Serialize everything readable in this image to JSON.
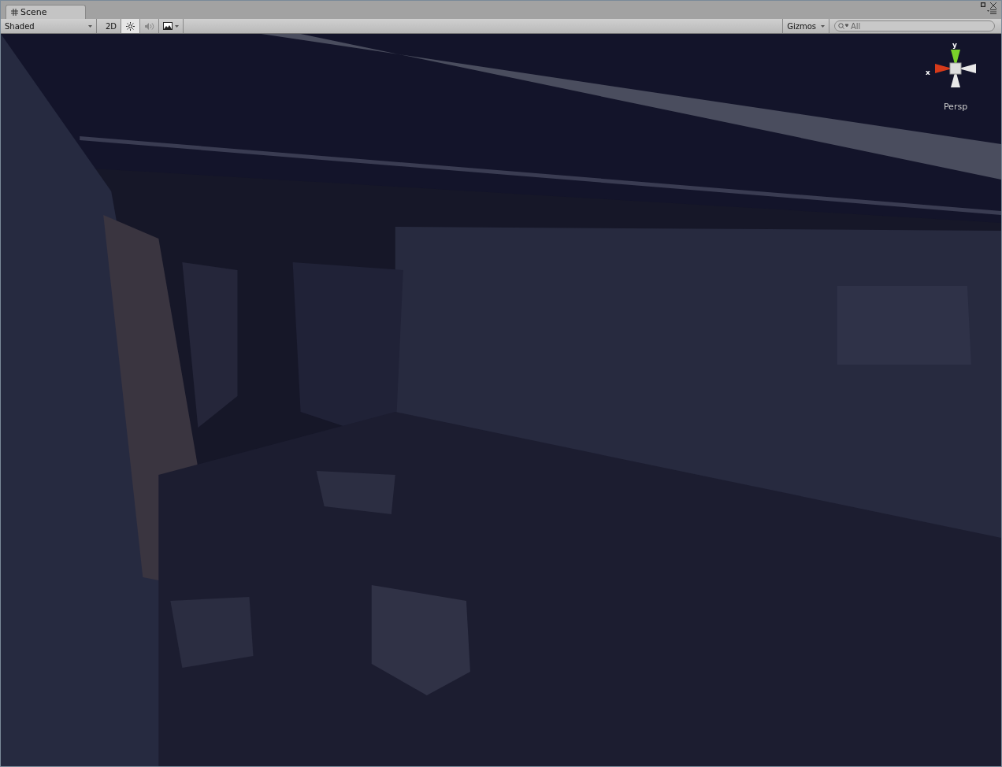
{
  "window": {
    "tab": {
      "title": "Scene",
      "selected": true
    }
  },
  "toolbar": {
    "draw_mode": "Shaded",
    "toggles": [
      {
        "kind": "text",
        "label": "2D",
        "on": false
      },
      {
        "kind": "light",
        "on": true
      },
      {
        "kind": "audio",
        "on": false
      },
      {
        "kind": "effects",
        "on": false
      }
    ],
    "gizmos": "Gizmos",
    "search": {
      "placeholder": "All"
    }
  },
  "viewport": {
    "gizmo": {
      "y_label": "y",
      "x_label": "x",
      "projection": "Persp"
    }
  }
}
